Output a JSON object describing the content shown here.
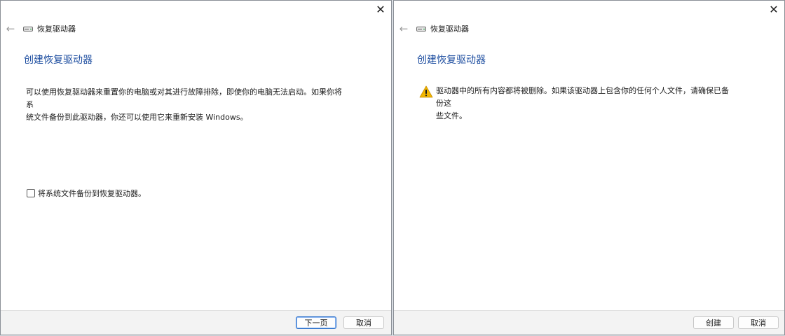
{
  "left_window": {
    "nav_title": "恢复驱动器",
    "heading": "创建恢复驱动器",
    "description_line1": "可以使用恢复驱动器来重置你的电脑或对其进行故障排除，即使你的电脑无法启动。如果你将系",
    "description_line2": "统文件备份到此驱动器，你还可以使用它来重新安装 Windows。",
    "checkbox_label": "将系统文件备份到恢复驱动器。",
    "checkbox_checked": false,
    "next_button": "下一页",
    "cancel_button": "取消"
  },
  "right_window": {
    "nav_title": "恢复驱动器",
    "heading": "创建恢复驱动器",
    "warning_line1": "驱动器中的所有内容都将被删除。如果该驱动器上包含你的任何个人文件，请确保已备份这",
    "warning_line2": "些文件。",
    "create_button": "创建",
    "cancel_button": "取消"
  },
  "icons": {
    "close": "close-icon",
    "back": "back-arrow-icon",
    "drive": "drive-icon",
    "warning": "warning-icon"
  },
  "colors": {
    "heading": "#1e4ea0",
    "primary_border": "#2a6fc9",
    "warning": "#f2b600"
  }
}
